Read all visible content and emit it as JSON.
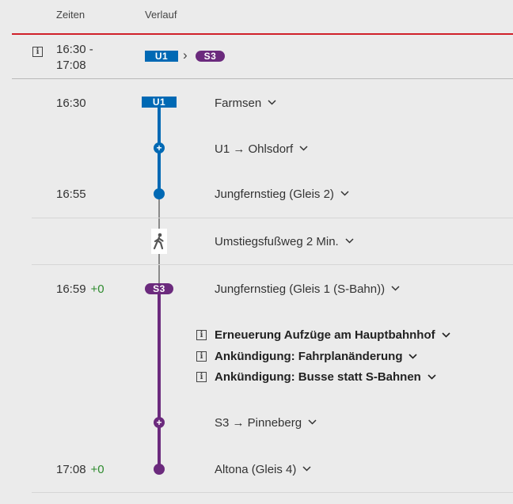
{
  "header": {
    "col_times": "Zeiten",
    "col_route": "Verlauf"
  },
  "summary": {
    "time_range": "16:30 -",
    "time_end": "17:08",
    "lines": [
      "U1",
      "S3"
    ],
    "separator": "›"
  },
  "legs": {
    "u1_badge": "U1",
    "s3_badge": "S3",
    "stops": [
      {
        "time": "16:30",
        "delay": "",
        "label": "Farmsen"
      },
      {
        "time": "",
        "delay": "",
        "label": "U1 → Ohlsdorf"
      },
      {
        "time": "16:55",
        "delay": "",
        "label": "Jungfernstieg (Gleis 2)"
      },
      {
        "time": "",
        "delay": "",
        "label": "Umstiegsfußweg 2 Min."
      },
      {
        "time": "16:59",
        "delay": "+0",
        "label": "Jungfernstieg (Gleis 1 (S-Bahn))"
      },
      {
        "time": "",
        "delay": "",
        "label": "S3 → Pinneberg"
      },
      {
        "time": "17:08",
        "delay": "+0",
        "label": "Altona (Gleis 4)"
      }
    ],
    "notices": [
      "Erneuerung Aufzüge am Hauptbahnhof",
      "Ankündigung: Fahrplanänderung",
      "Ankündigung: Busse statt S-Bahnen"
    ]
  },
  "colors": {
    "u1": "#0069b4",
    "s3": "#6b2a7d",
    "accent_red": "#d0202a",
    "delay_green": "#2e8b2e"
  },
  "icons": {
    "info": "info-icon",
    "chevron": "chevron-down-icon",
    "walk": "walking-person-icon",
    "plus": "plus-icon"
  }
}
